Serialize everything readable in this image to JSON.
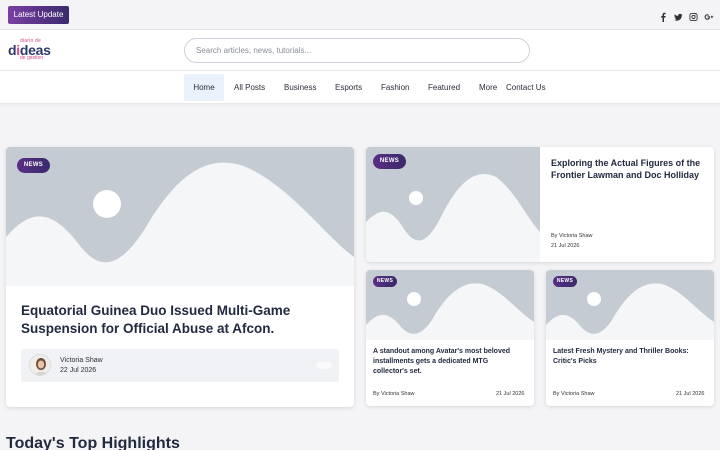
{
  "topbar": {
    "latest_update_label": "Latest Update",
    "social_icons": [
      "facebook-icon",
      "twitter-icon",
      "instagram-icon",
      "google-plus-icon"
    ]
  },
  "header": {
    "logo": {
      "text_top": "diario de",
      "text_main_a": "d",
      "text_main_b": "i",
      "text_main_c": "deas",
      "text_bottom": "de gestion"
    },
    "search": {
      "placeholder": "Search articles, news, tutorials...",
      "value": ""
    }
  },
  "nav": {
    "items": [
      "Home",
      "All Posts",
      "Business",
      "Esports",
      "Fashion",
      "Featured",
      "More",
      "Contact Us"
    ],
    "active": "Home"
  },
  "featured": {
    "badge": "NEWS",
    "title": "Equatorial Guinea Duo Issued Multi-Game Suspension for Official Abuse at Afcon.",
    "author": "Victoria Shaw",
    "date": "22 Jul 2026"
  },
  "right_top": {
    "badge": "NEWS",
    "title": "Exploring the Actual Figures of the Frontier Lawman and Doc Holliday",
    "byline": "By Victoria Shaw",
    "date": "21 Jul 2026"
  },
  "small_cards": [
    {
      "badge": "NEWS",
      "title": "A standout among Avatar's most beloved installments gets a dedicated MTG collector's set.",
      "byline": "By Victoria Shaw",
      "date": "21 Jul 2026"
    },
    {
      "badge": "NEWS",
      "title": "Latest Fresh Mystery and Thriller Books: Critic's Picks",
      "byline": "By Victoria Shaw",
      "date": "21 Jul 2026"
    }
  ],
  "sections": {
    "top_highlights": "Today's Top Highlights"
  },
  "colors": {
    "accent": "#5a2f86",
    "placeholder_bg": "#c5cbd3",
    "nav_active_bg": "#e9f1fb"
  }
}
